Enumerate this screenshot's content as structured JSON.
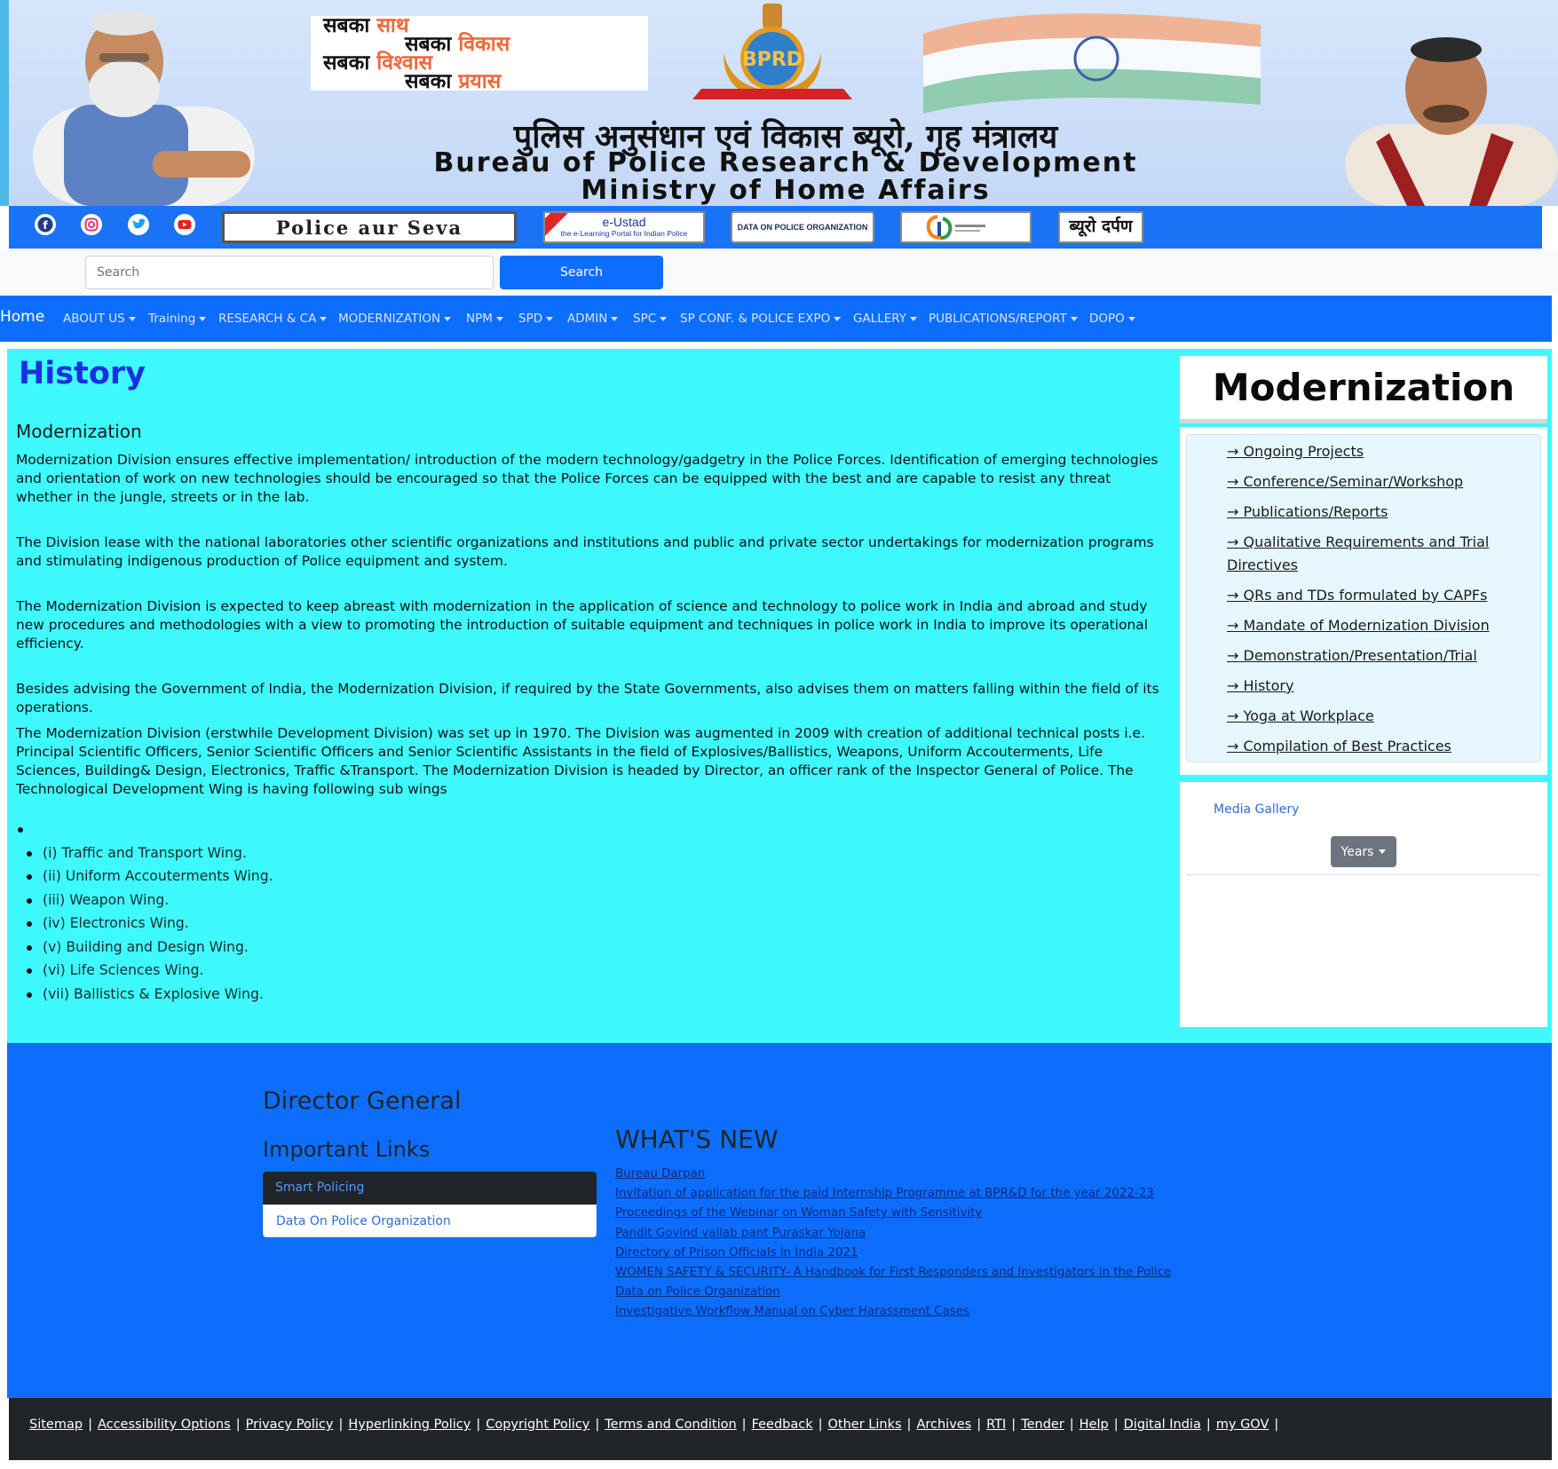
{
  "banner": {
    "slogan": [
      "सबका",
      "साथ",
      "सबका",
      "विकास",
      "सबका",
      "विश्वास",
      "सबका",
      "प्रयास"
    ],
    "title_hindi": "पुलिस अनुसंधान एवं विकास ब्यूरो, गृह मंत्रालय",
    "title_en_line1": "Bureau of Police Research & Development",
    "title_en_line2": "Ministry of Home Affairs",
    "emblem_text": "BPRD"
  },
  "social_bar": {
    "icons": [
      "facebook-icon",
      "instagram-icon",
      "twitter-icon",
      "youtube-icon"
    ],
    "logos": {
      "police_aur_seva": "Police aur Seva",
      "e_ustad_title": "e-Ustad",
      "e_ustad_sub": "the e-Learning Portal for Indian Police",
      "data_on_police": "DATA ON POLICE ORGANIZATION",
      "bureau_darpan": "ब्यूरो दर्पण"
    }
  },
  "search": {
    "placeholder": "Search",
    "button_label": "Search"
  },
  "nav": {
    "home": "Home",
    "items": [
      "ABOUT US",
      "Training",
      "RESEARCH & CA",
      "MODERNIZATION",
      "NPM",
      "SPD",
      "ADMIN",
      "SPC",
      "SP CONF. & POLICE EXPO",
      "GALLERY",
      "PUBLICATIONS/REPORT",
      "DOPO"
    ]
  },
  "main": {
    "page_heading": "History",
    "section_heading": "Modernization",
    "paragraphs": [
      "Modernization Division ensures effective implementation/ introduction of the modern technology/gadgetry in the Police Forces. Identification of emerging technologies and orientation of work on new technologies should be encouraged so that the Police Forces can be equipped with the best and are capable to resist any threat whether in the jungle, streets or in the lab.",
      "The Division lease with the national laboratories other scientific organizations and institutions and public and private sector undertakings for modernization programs and stimulating indigenous production of Police equipment and system.",
      "The Modernization Division is expected to keep abreast with modernization in the application of science and technology to police work in India and abroad and study new procedures and methodologies with a view to promoting the introduction of suitable equipment and techniques in police work in India to improve its operational efficiency.",
      "Besides advising the Government of India, the Modernization Division, if required by the State Governments, also advises them on matters falling within the field of its operations.",
      "The Modernization Division (erstwhile Development Division) was set up in 1970. The Division was augmented in 2009 with creation of additional technical posts i.e. Principal Scientific Officers, Senior Scientific Officers and Senior Scientific Assistants in the field of Explosives/Ballistics, Weapons, Uniform Accouterments, Life Sciences, Building& Design, Electronics, Traffic &Transport. The Modernization Division is headed by Director, an officer rank of the Inspector General of Police. The Technological Development Wing is having following sub wings"
    ],
    "wings": [
      "",
      "(i) Traffic and Transport Wing.",
      "(ii) Uniform Accouterments Wing.",
      "(iii) Weapon Wing.",
      "(iv) Electronics Wing.",
      "(v) Building and Design Wing.",
      "(vi) Life Sciences Wing.",
      "(vii) Ballistics & Explosive Wing."
    ]
  },
  "sidebar": {
    "title": "Modernization",
    "links": [
      "→ Ongoing Projects",
      "→ Conference/Seminar/Workshop",
      "→ Publications/Reports",
      "→ Qualitative Requirements and Trial Directives",
      "→ QRs and TDs formulated by CAPFs",
      "→ Mandate of Modernization Division",
      "→ Demonstration/Presentation/Trial",
      "→ History",
      "→ Yoga at Workplace",
      "→ Compilation of Best Practices"
    ],
    "media_gallery": "Media Gallery",
    "years_button": "Years"
  },
  "footer": {
    "director_general": "Director General",
    "important_links_heading": "Important Links",
    "important_links": [
      "Smart Policing",
      "Data On Police Organization"
    ],
    "whats_new_heading": "WHAT'S NEW",
    "whats_new": [
      "Bureau Darpan",
      "Invitation of application for the paid Internship Programme at BPR&D for the year 2022-23",
      "Proceedings of the Webinar on Woman Safety with Sensitivity",
      "Pandit Govind vallab pant Puraskar Yojana",
      "Directory of Prison Officials in India 2021",
      "WOMEN SAFETY & SECURITY- A Handbook for First Responders and Investigators in the Police",
      "Data on Police Organization",
      "Investigative Workflow Manual on Cyber Harassment Cases"
    ]
  },
  "bottom_links": [
    "Sitemap",
    "Accessibility Options",
    "Privacy Policy",
    "Hyperlinking Policy",
    "Copyright Policy",
    "Terms and Condition",
    "Feedback",
    "Other Links",
    "Archives",
    "RTI",
    "Tender",
    "Help",
    "Digital India",
    "my GOV"
  ],
  "colors": {
    "nav_blue": "#0d6efd",
    "main_background": "#3efaff",
    "heading_blue": "#1b2fe0",
    "bottom_bar": "#212529"
  }
}
